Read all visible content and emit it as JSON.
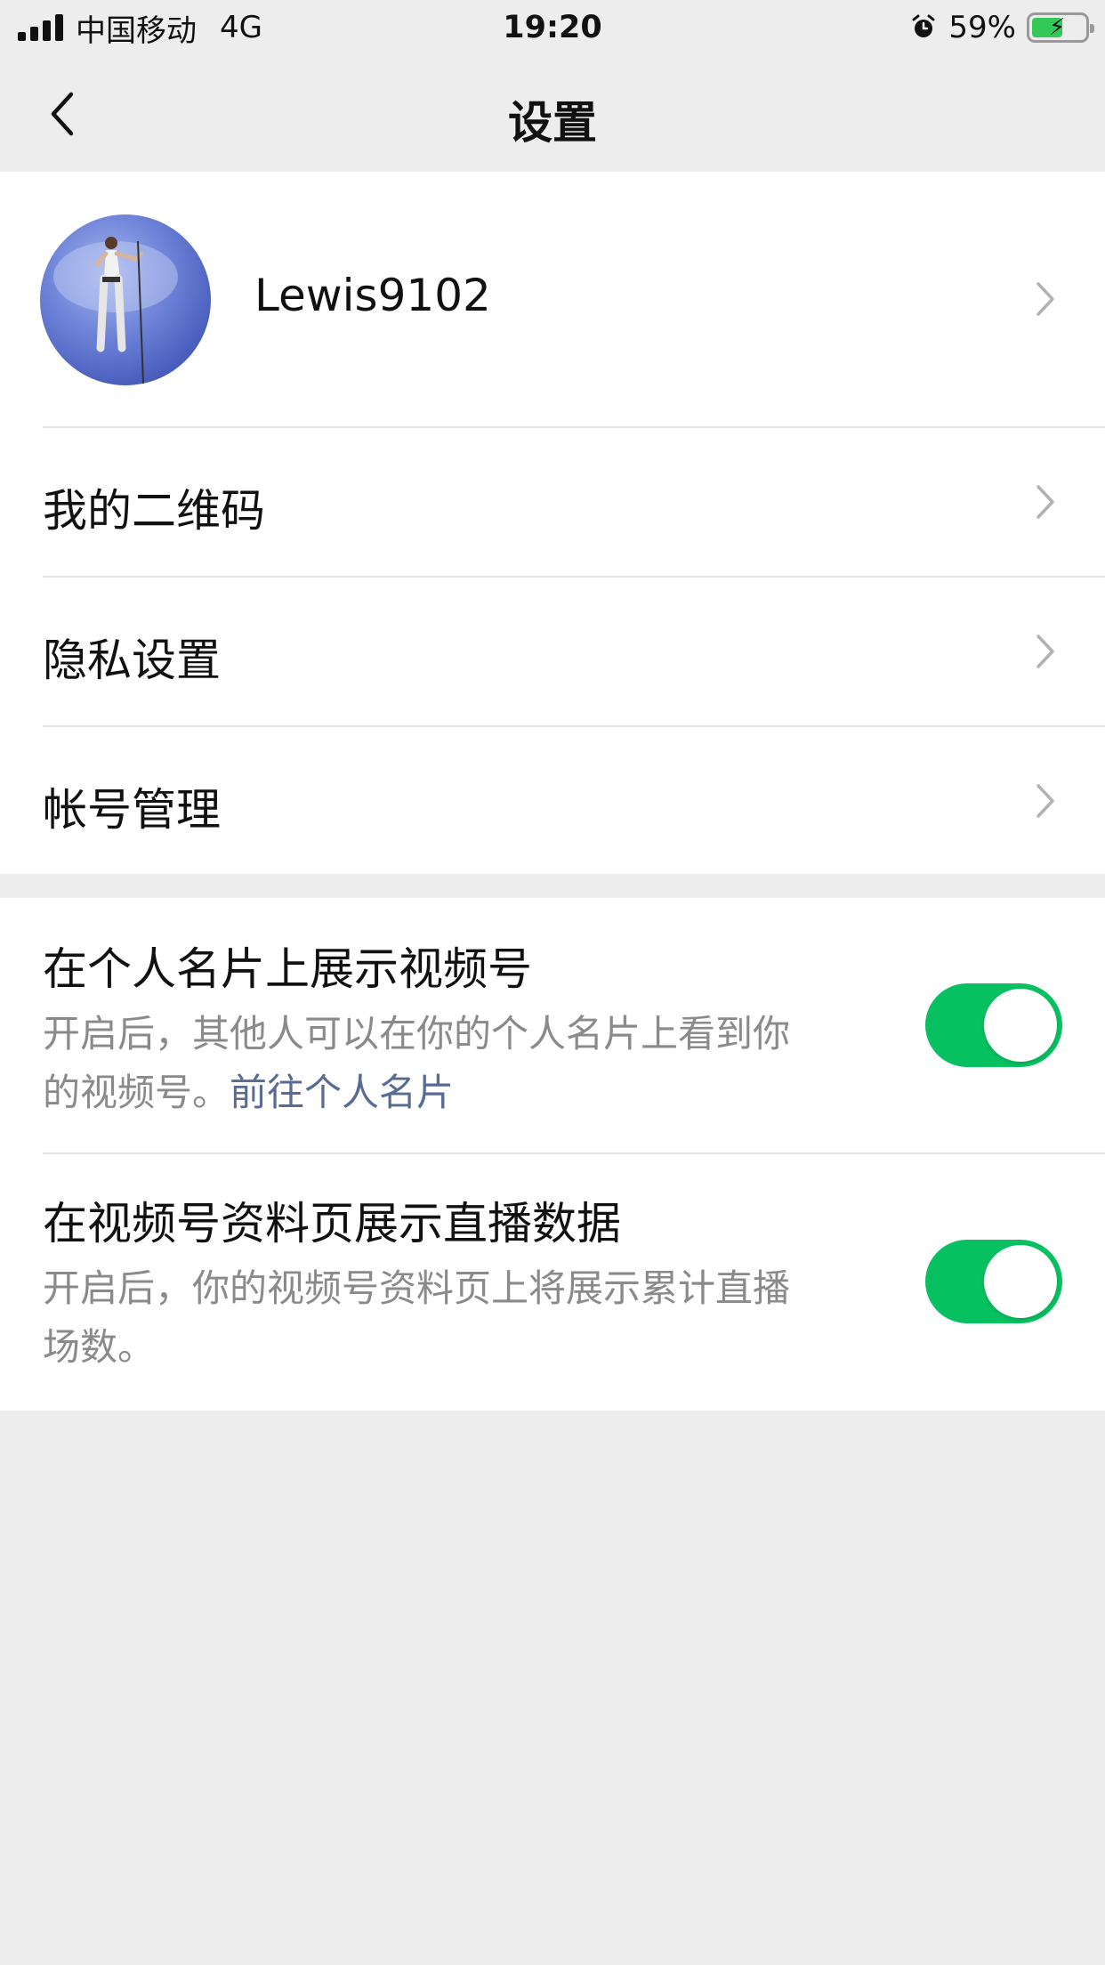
{
  "status_bar": {
    "carrier": "中国移动",
    "network": "4G",
    "time": "19:20",
    "battery_percent": "59%",
    "battery_level": 0.59,
    "icons": [
      "signal-icon",
      "alarm-icon",
      "battery-charging-icon"
    ]
  },
  "nav": {
    "title": "设置",
    "back_icon": "chevron-left-icon"
  },
  "profile": {
    "username": "Lewis9102"
  },
  "menu": {
    "items": [
      {
        "label": "我的二维码"
      },
      {
        "label": "隐私设置"
      },
      {
        "label": "帐号管理"
      }
    ]
  },
  "toggles": {
    "items": [
      {
        "title": "在个人名片上展示视频号",
        "desc_line1": "开启后，其他人可以在你的个人名片上看到你",
        "desc_line2_prefix": "的视频号。",
        "link": "前往个人名片",
        "enabled": true
      },
      {
        "title": "在视频号资料页展示直播数据",
        "desc_line1": "开启后，你的视频号资料页上将展示累计直播",
        "desc_line2_prefix": "场数。",
        "enabled": true
      }
    ]
  },
  "colors": {
    "accent_green": "#07c160",
    "link_blue": "#576b95",
    "background": "#ededed"
  }
}
